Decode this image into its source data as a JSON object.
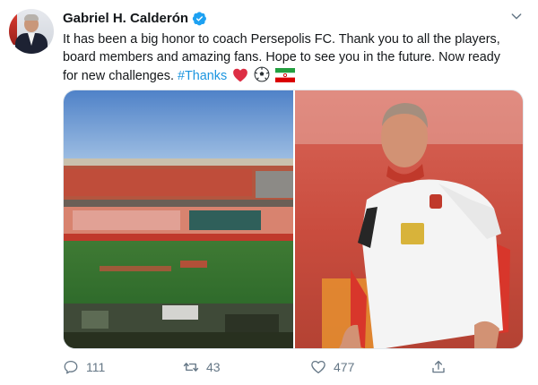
{
  "author": {
    "name": "Gabriel H. Calderón"
  },
  "tweet": {
    "line1": "It has been a big honor to coach Persepolis FC. Thank you to all the players,",
    "line2": "board members and amazing fans. Hope to see you in the future. Now ready",
    "line3": "for new challenges. ",
    "hashtag": "#Thanks"
  },
  "actions": {
    "replies": "111",
    "retweets": "43",
    "likes": "477"
  },
  "colors": {
    "accent": "#1b95e0",
    "verified": "#1da1f2",
    "muted": "#657786",
    "text": "#14171a"
  },
  "icons": [
    "verified-badge-icon",
    "chevron-down-icon",
    "reply-icon",
    "retweet-icon",
    "like-icon",
    "share-icon",
    "heart-emoji-icon",
    "soccer-ball-emoji-icon",
    "iran-flag-emoji-icon"
  ]
}
